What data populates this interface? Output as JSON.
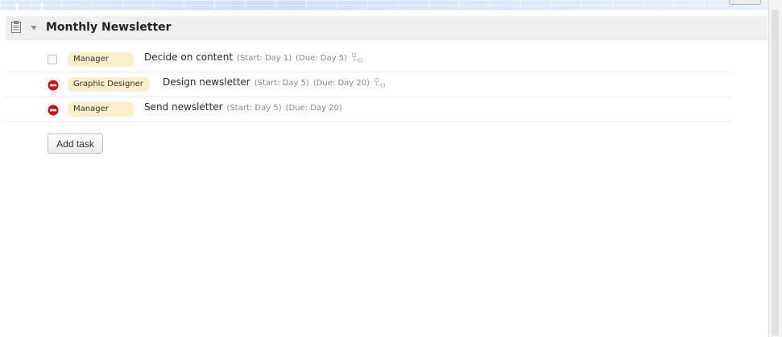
{
  "section": {
    "title": "Monthly Newsletter",
    "icon": "clipboard-icon",
    "collapse_icon": "triangle-down-icon"
  },
  "tasks": [
    {
      "status": "checkbox",
      "role": "Manager",
      "name": "Decide on content",
      "start": "(Start: Day 1)",
      "due": "(Due: Day 5)",
      "has_dependency_icon": true
    },
    {
      "status": "blocked",
      "role": "Graphic Designer",
      "name": "Design newsletter",
      "start": "(Start: Day 5)",
      "due": "(Due: Day 20)",
      "has_dependency_icon": true
    },
    {
      "status": "blocked",
      "role": "Manager",
      "name": "Send newsletter",
      "start": "(Start: Day 5)",
      "due": "(Due: Day 20)",
      "has_dependency_icon": false
    }
  ],
  "add_task_label": "Add task",
  "colors": {
    "role_badge": "#f9efc8",
    "blocked": "#cc1111",
    "header_bg": "#eeeeee"
  }
}
